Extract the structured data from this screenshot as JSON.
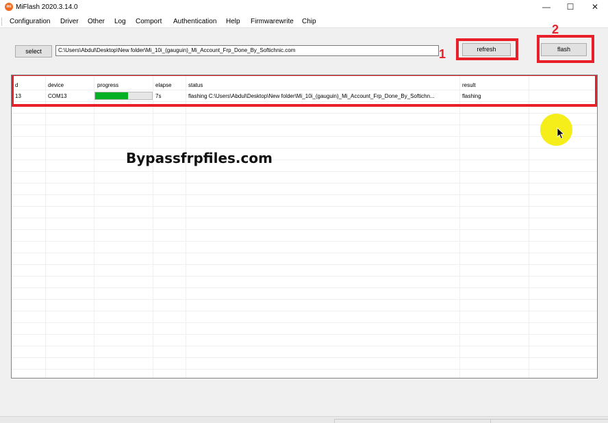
{
  "window": {
    "title": "MiFlash 2020.3.14.0",
    "app_icon_text": "mi",
    "minimize_glyph": "—",
    "maximize_glyph": "☐",
    "close_glyph": "✕"
  },
  "menu": {
    "items": [
      "Configuration",
      "Driver",
      "Other",
      "Log",
      "Comport",
      "Authentication",
      "Help",
      "Firmwarewrite",
      "Chip"
    ]
  },
  "toolbar": {
    "select_label": "select",
    "path_value": "C:\\Users\\Abdul\\Desktop\\New folder\\Mi_10i_(gauguin)_Mi_Account_Frp_Done_By_Softichnic.com",
    "refresh_label": "refresh",
    "flash_label": "flash"
  },
  "annotations": {
    "marker_1": "1",
    "marker_2": "2",
    "watermark": "Bypassfrpfiles.com",
    "highlight_color": "#e8202a"
  },
  "table": {
    "headers": [
      "d",
      "device",
      "progress",
      "elapse",
      "status",
      "result"
    ],
    "rows": [
      {
        "id": "13",
        "device": "COM13",
        "progress": 0.58,
        "elapse": "7s",
        "status": "flashing C:\\Users\\Abdul\\Desktop\\New folder\\Mi_10i_(gauguin)_Mi_Account_Frp_Done_By_Softichn...",
        "result": "flashing"
      }
    ]
  },
  "colors": {
    "progress_fill": "#06b025",
    "cursor_highlight": "#f5ee1a"
  }
}
